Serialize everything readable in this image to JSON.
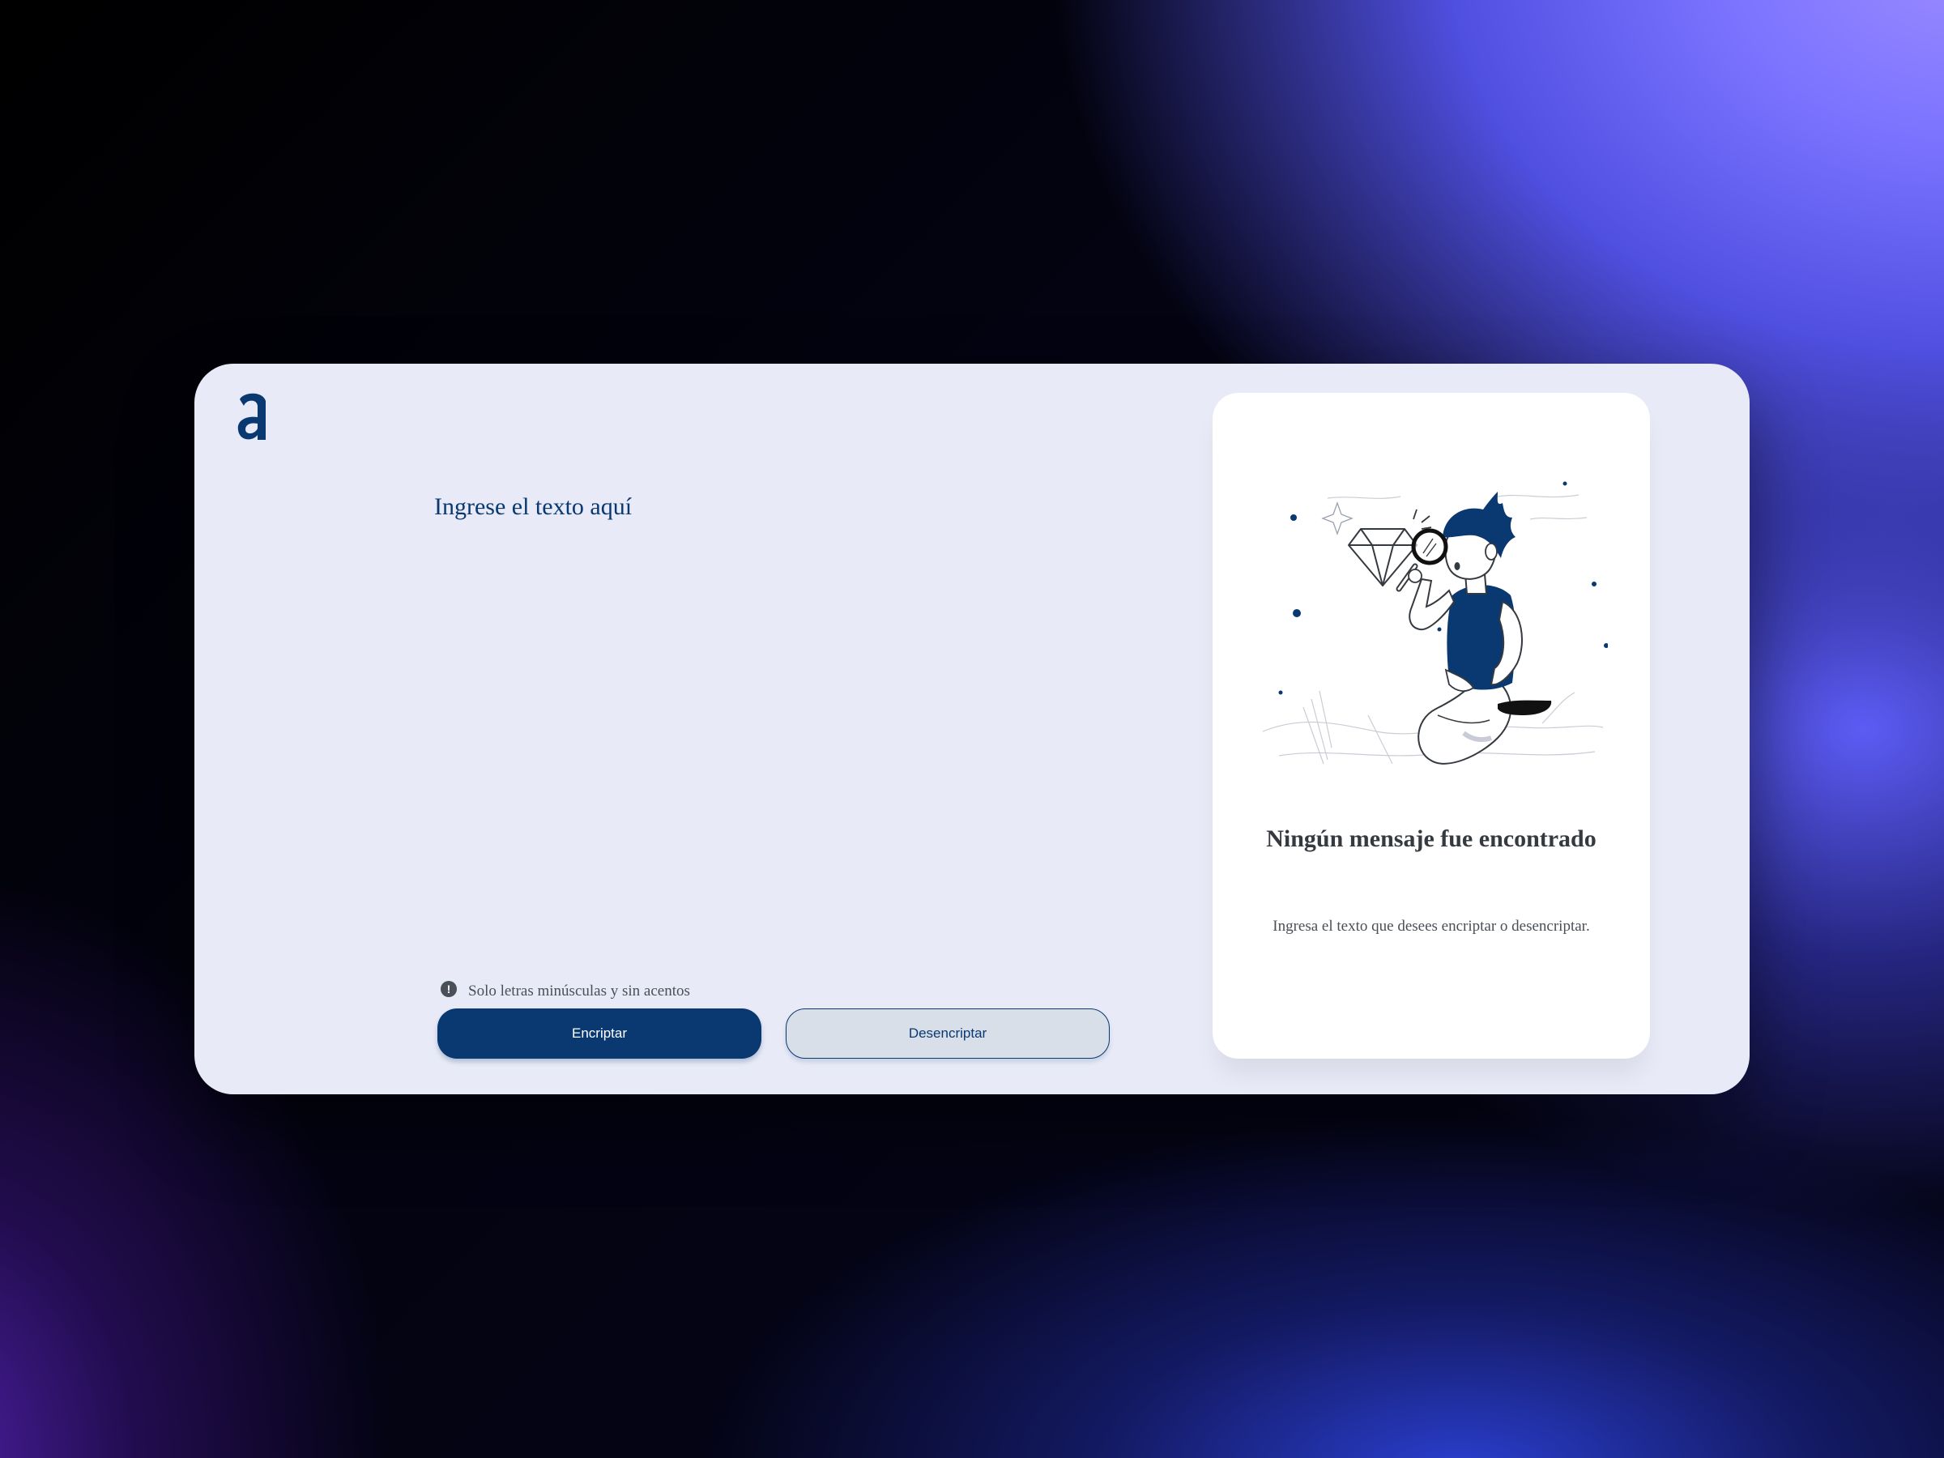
{
  "app": {
    "logo_icon": "alura-a-logo-icon"
  },
  "input": {
    "placeholder": "Ingrese el texto aquí",
    "value": ""
  },
  "hint": {
    "icon": "exclamation-circle-icon",
    "text": "Solo letras minúsculas y sin acentos"
  },
  "buttons": {
    "encrypt_label": "Encriptar",
    "decrypt_label": "Desencriptar"
  },
  "output": {
    "illustration": "person-searching-with-magnifier-illustration",
    "title": "Ningún mensaje fue encontrado",
    "subtitle": "Ingresa el texto que desees encriptar o desencriptar."
  },
  "colors": {
    "primary": "#0a3871",
    "card_background": "#e8eaf7",
    "panel_background": "#ffffff",
    "secondary_button_bg": "#d8dfe8",
    "text_dark": "#343a40",
    "text_muted": "#495057"
  }
}
